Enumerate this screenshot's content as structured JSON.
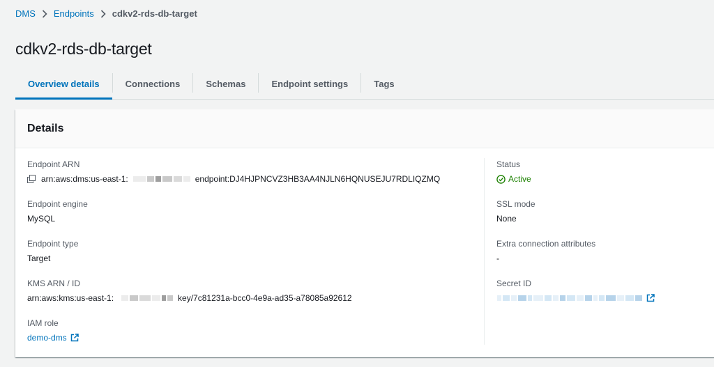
{
  "breadcrumb": {
    "root": "DMS",
    "parent": "Endpoints",
    "current": "cdkv2-rds-db-target"
  },
  "page_title": "cdkv2-rds-db-target",
  "tabs": [
    "Overview details",
    "Connections",
    "Schemas",
    "Endpoint settings",
    "Tags"
  ],
  "active_tab": "Overview details",
  "panel": {
    "title": "Details",
    "left": {
      "endpoint_arn": {
        "label": "Endpoint ARN",
        "prefix": "arn:aws:dms:us-east-1:",
        "suffix": "endpoint:DJ4HJPNCVZ3HB3AA4NJLN6HQNUSEJU7RDLIQZMQ"
      },
      "engine": {
        "label": "Endpoint engine",
        "value": "MySQL"
      },
      "type": {
        "label": "Endpoint type",
        "value": "Target"
      },
      "kms": {
        "label": "KMS ARN / ID",
        "prefix": "arn:aws:kms:us-east-1:",
        "suffix": "key/7c81231a-bcc0-4e9a-ad35-a78085a92612"
      },
      "iam": {
        "label": "IAM role",
        "value": "demo-dms"
      }
    },
    "right": {
      "status": {
        "label": "Status",
        "value": "Active"
      },
      "ssl": {
        "label": "SSL mode",
        "value": "None"
      },
      "extra": {
        "label": "Extra connection attributes",
        "value": "-"
      },
      "secret": {
        "label": "Secret ID"
      }
    }
  },
  "colors": {
    "link": "#0073bb",
    "success": "#1d8102",
    "text": "#16191f",
    "muted": "#545b64"
  },
  "icons": [
    "chevron-right-icon",
    "copy-icon",
    "status-check-icon",
    "external-link-icon"
  ]
}
